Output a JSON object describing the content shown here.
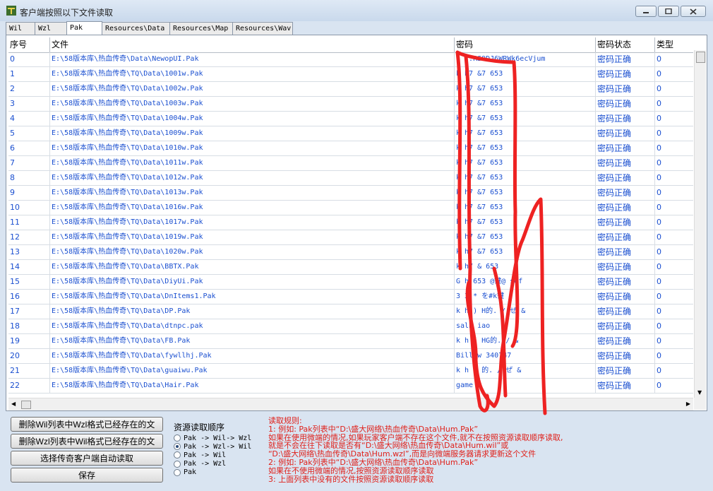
{
  "window": {
    "title": "客户端按照以下文件读取",
    "minimize_icon": "minimize-icon",
    "maximize_icon": "maximize-icon",
    "close_icon": "close-icon"
  },
  "tabs": [
    {
      "label": "Wil",
      "active": false
    },
    {
      "label": "Wzl",
      "active": false
    },
    {
      "label": "Pak",
      "active": true
    },
    {
      "label": "Resources\\Data",
      "active": false
    },
    {
      "label": "Resources\\Map",
      "active": false
    },
    {
      "label": "Resources\\Wav",
      "active": false
    }
  ],
  "table": {
    "headers": [
      "序号",
      "文件",
      "密码",
      "密码状态",
      "类型"
    ],
    "rows": [
      {
        "idx": "0",
        "file": "E:\\58版本库\\热血传奇\\Data\\NewopUI.Pak",
        "pwd": "z    T:RS9DJ6WRWk6ecVjum",
        "status": "密码正确",
        "type": "0"
      },
      {
        "idx": "1",
        "file": "E:\\58版本库\\热血传奇\\TQ\\Data\\1001w.Pak",
        "pwd": "k    h7              &7     653",
        "status": "密码正确",
        "type": "0"
      },
      {
        "idx": "2",
        "file": "E:\\58版本库\\热血传奇\\TQ\\Data\\1002w.Pak",
        "pwd": "k    h7              &7     653",
        "status": "密码正确",
        "type": "0"
      },
      {
        "idx": "3",
        "file": "E:\\58版本库\\热血传奇\\TQ\\Data\\1003w.Pak",
        "pwd": "k    h7              &7     653",
        "status": "密码正确",
        "type": "0"
      },
      {
        "idx": "4",
        "file": "E:\\58版本库\\热血传奇\\TQ\\Data\\1004w.Pak",
        "pwd": "k    h7              &7     653",
        "status": "密码正确",
        "type": "0"
      },
      {
        "idx": "5",
        "file": "E:\\58版本库\\热血传奇\\TQ\\Data\\1009w.Pak",
        "pwd": "k    h7              &7     653",
        "status": "密码正确",
        "type": "0"
      },
      {
        "idx": "6",
        "file": "E:\\58版本库\\热血传奇\\TQ\\Data\\1010w.Pak",
        "pwd": "k    h7              &7     653",
        "status": "密码正确",
        "type": "0"
      },
      {
        "idx": "7",
        "file": "E:\\58版本库\\热血传奇\\TQ\\Data\\1011w.Pak",
        "pwd": "k    h7              &7     653",
        "status": "密码正确",
        "type": "0"
      },
      {
        "idx": "8",
        "file": "E:\\58版本库\\热血传奇\\TQ\\Data\\1012w.Pak",
        "pwd": "k    h7              &7     653",
        "status": "密码正确",
        "type": "0"
      },
      {
        "idx": "9",
        "file": "E:\\58版本库\\热血传奇\\TQ\\Data\\1013w.Pak",
        "pwd": "k    h7              &7     653",
        "status": "密码正确",
        "type": "0"
      },
      {
        "idx": "10",
        "file": "E:\\58版本库\\热血传奇\\TQ\\Data\\1016w.Pak",
        "pwd": "k    h7              &7     653",
        "status": "密码正确",
        "type": "0"
      },
      {
        "idx": "11",
        "file": "E:\\58版本库\\热血传奇\\TQ\\Data\\1017w.Pak",
        "pwd": "k    h7              &7     653",
        "status": "密码正确",
        "type": "0"
      },
      {
        "idx": "12",
        "file": "E:\\58版本库\\热血传奇\\TQ\\Data\\1019w.Pak",
        "pwd": "k    h7              &7     653",
        "status": "密码正确",
        "type": "0"
      },
      {
        "idx": "13",
        "file": "E:\\58版本库\\热血传奇\\TQ\\Data\\1020w.Pak",
        "pwd": "k    h7              &7     653",
        "status": "密码正确",
        "type": "0"
      },
      {
        "idx": "14",
        "file": "E:\\58版本库\\热血传奇\\TQ\\Data\\BBTX.Pak",
        "pwd": "k    h7              &      653",
        "status": "密码正确",
        "type": "0"
      },
      {
        "idx": "15",
        "file": "E:\\58版本库\\热血传奇\\TQ\\Data\\DiyUi.Pak",
        "pwd": "    G    h   653   @键@   sdf",
        "status": "密码正确",
        "type": "0"
      },
      {
        "idx": "16",
        "file": "E:\\58版本库\\热血传奇\\TQ\\Data\\DnItems1.Pak",
        "pwd": "    3  3          *       を#k键",
        "status": "密码正确",
        "type": "0"
      },
      {
        "idx": "17",
        "file": "E:\\58版本库\\热血传奇\\TQ\\Data\\DP.Pak",
        "pwd": "k  h    ) H的.   /     ぜ    &",
        "status": "密码正确",
        "type": "0"
      },
      {
        "idx": "18",
        "file": "E:\\58版本库\\热血传奇\\TQ\\Data\\dtnpc.pak",
        "pwd": "salh  iao",
        "status": "密码正确",
        "type": "0"
      },
      {
        "idx": "19",
        "file": "E:\\58版本库\\热血传奇\\TQ\\Data\\FB.Pak",
        "pwd": "k  h   (  HG的.  /          &",
        "status": "密码正确",
        "type": "0"
      },
      {
        "idx": "20",
        "file": "E:\\58版本库\\热血传奇\\TQ\\Data\\fywllhj.Pak",
        "pwd": "Bill  w  340747",
        "status": "密码正确",
        "type": "0"
      },
      {
        "idx": "21",
        "file": "E:\\58版本库\\热血传奇\\TQ\\Data\\guaiwu.Pak",
        "pwd": "k  h    ) 的.   /     ぜ    &",
        "status": "密码正确",
        "type": "0"
      },
      {
        "idx": "22",
        "file": "E:\\58版本库\\热血传奇\\TQ\\Data\\Hair.Pak",
        "pwd": "game  i",
        "status": "密码正确",
        "type": "0"
      }
    ]
  },
  "buttons": {
    "delete_wil": "删除Wil列表中Wzl格式已经存在的文件",
    "delete_wzl": "删除Wzl列表中Wil格式已经存在的文件",
    "select_client": "选择传奇客户端自动读取",
    "save": "保存"
  },
  "resource_order": {
    "title": "资源读取顺序",
    "options": [
      {
        "label": "Pak -> Wil-> Wzl",
        "selected": false
      },
      {
        "label": "Pak -> Wzl-> Wil",
        "selected": true
      },
      {
        "label": "Pak -> Wil",
        "selected": false
      },
      {
        "label": "Pak -> Wzl",
        "selected": false
      },
      {
        "label": "Pak",
        "selected": false
      }
    ]
  },
  "rules": {
    "lines": [
      "读取规则:",
      "1: 例如: Pak列表中“D:\\盛大网络\\热血传奇\\Data\\Hum.Pak”",
      "    如果在使用微端的情况,如果玩家客户端不存在这个文件,就不在按照资源读取顺序读取,",
      "    就是不会在往下读取是否有“D:\\盛大网络\\热血传奇\\Data\\Hum.wil”或",
      "  “D:\\盛大网络\\热血传奇\\Data\\Hum.wzl”,而是向微端服务器请求更新这个文件",
      "2: 例如: Pak列表中“D:\\盛大网络\\热血传奇\\Data\\Hum.Pak”",
      "    如果在不使用微端的情况,按照资源读取顺序读取",
      "3: 上面列表中没有的文件按照资源读取顺序读取"
    ],
    "color": "#e0201a"
  },
  "colors": {
    "link_blue": "#1a4fd0",
    "annotation_red": "#ee2222"
  }
}
